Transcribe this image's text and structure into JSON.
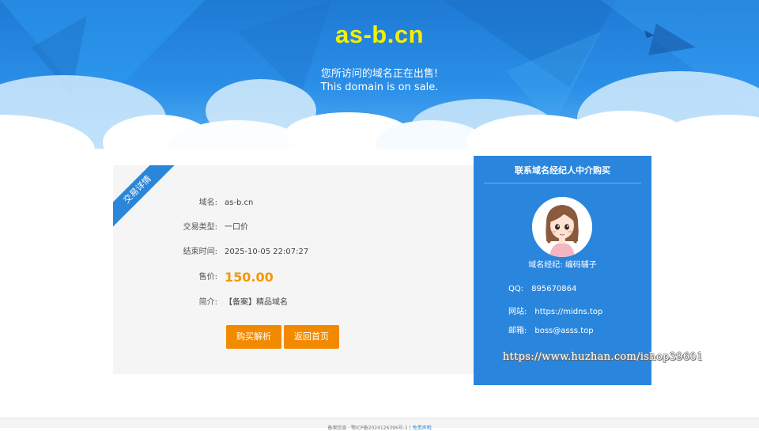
{
  "hero": {
    "domain": "as-b.cn",
    "subtitle_cn": "您所访问的域名正在出售!",
    "subtitle_en": "This domain is on sale."
  },
  "detail": {
    "ribbon": "交易详情",
    "rows": [
      {
        "label": "域名:",
        "value": "as-b.cn"
      },
      {
        "label": "交易类型:",
        "value": "一口价"
      },
      {
        "label": "结束时间:",
        "value": "2025-10-05 22:07:27"
      },
      {
        "label": "售价:",
        "value": "150.00"
      },
      {
        "label": "简介:",
        "value": "【备案】精品域名"
      }
    ],
    "buttons": {
      "buy": "购买解析",
      "home": "返回首页"
    }
  },
  "broker": {
    "title": "联系域名经纪人中介购买",
    "agent_label": "域名经纪:",
    "agent_name": "编码辅子",
    "contacts": [
      {
        "key": "QQ:",
        "value": "895670864"
      },
      {
        "key": "网站:",
        "value": "https://midns.top"
      },
      {
        "key": "邮箱:",
        "value": "boss@asss.top"
      }
    ]
  },
  "watermark": "https://www.huzhan.com/ishop39601",
  "footer": {
    "text": "备案信息 · 鄂ICP备2024126396号-1 |",
    "link": "免责声明"
  },
  "colors": {
    "hero_blue": "#2a8fe8",
    "domain_yellow": "#f4f000",
    "price_orange": "#f39800",
    "button_orange": "#f28a00",
    "panel_blue": "#2a86dc"
  }
}
